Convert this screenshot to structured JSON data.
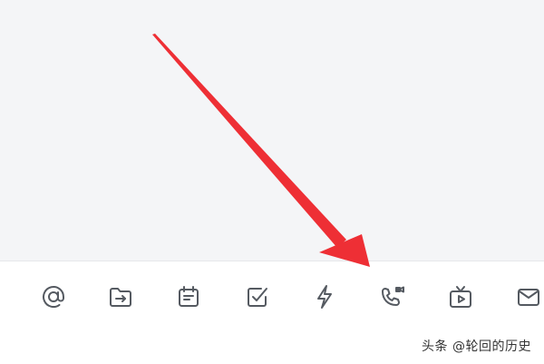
{
  "toolbar": {
    "buttons": [
      {
        "icon": "at-mention-icon"
      },
      {
        "icon": "folder-transfer-icon"
      },
      {
        "icon": "calendar-icon"
      },
      {
        "icon": "checkbox-task-icon"
      },
      {
        "icon": "lightning-icon"
      },
      {
        "icon": "phone-video-call-icon"
      },
      {
        "icon": "tv-play-icon"
      },
      {
        "icon": "mail-icon"
      }
    ]
  },
  "annotation": {
    "arrow_color": "#ee2f35"
  },
  "watermark": {
    "text": "头条 @轮回的历史"
  },
  "colors": {
    "icon_stroke": "#555a61",
    "toolbar_bg": "#ffffff",
    "content_bg": "#f4f5f7"
  }
}
